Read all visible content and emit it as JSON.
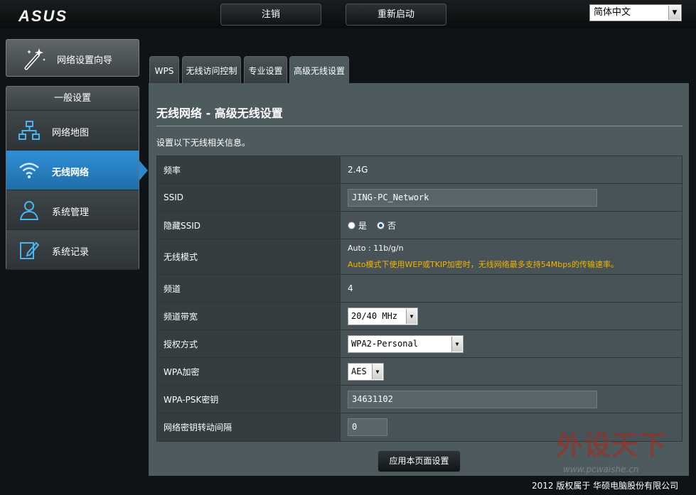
{
  "brand": {
    "logo": "ASUS"
  },
  "header": {
    "logout_label": "注销",
    "reboot_label": "重新启动",
    "language": "简体中文"
  },
  "sidebar": {
    "wizard_label": "网络设置向导",
    "section_title": "一般设置",
    "items": [
      {
        "label": "网络地图",
        "icon": "network-map-icon"
      },
      {
        "label": "无线网络",
        "icon": "wifi-icon",
        "active": true
      },
      {
        "label": "系统管理",
        "icon": "admin-icon"
      },
      {
        "label": "系统记录",
        "icon": "log-icon"
      }
    ]
  },
  "tabs": [
    "WPS",
    "无线访问控制",
    "专业设置",
    "高级无线设置"
  ],
  "main": {
    "title": "无线网络 - 高级无线设置",
    "description": "设置以下无线相关信息。",
    "rows": {
      "band": {
        "label": "频率",
        "value": "2.4G"
      },
      "ssid": {
        "label": "SSID",
        "value": "JING-PC_Network"
      },
      "hide_ssid": {
        "label": "隐藏SSID",
        "yes": "是",
        "no": "否",
        "selected": "否"
      },
      "mode": {
        "label": "无线模式",
        "value": "Auto : 11b/g/n",
        "warning": "Auto模式下使用WEP或TKIP加密时，无线网络最多支持54Mbps的传输速率。"
      },
      "channel": {
        "label": "频道",
        "value": "4"
      },
      "bandwidth": {
        "label": "频道带宽",
        "value": "20/40 MHz"
      },
      "auth": {
        "label": "授权方式",
        "value": "WPA2-Personal"
      },
      "wpa_enc": {
        "label": "WPA加密",
        "value": "AES"
      },
      "psk": {
        "label": "WPA-PSK密钥",
        "value": "34631102"
      },
      "rekey": {
        "label": "网络密钥转动间隔",
        "value": "0"
      }
    },
    "apply_label": "应用本页面设置"
  },
  "footer": {
    "copyright": "2012 版权属于 华硕电脑股份有限公司"
  },
  "watermark": {
    "text": "外设天下",
    "url": "www.pcwaishe.cn"
  },
  "colors": {
    "accent": "#2a88cf",
    "warning": "#f5b400",
    "panel": "#4d5a5e"
  }
}
